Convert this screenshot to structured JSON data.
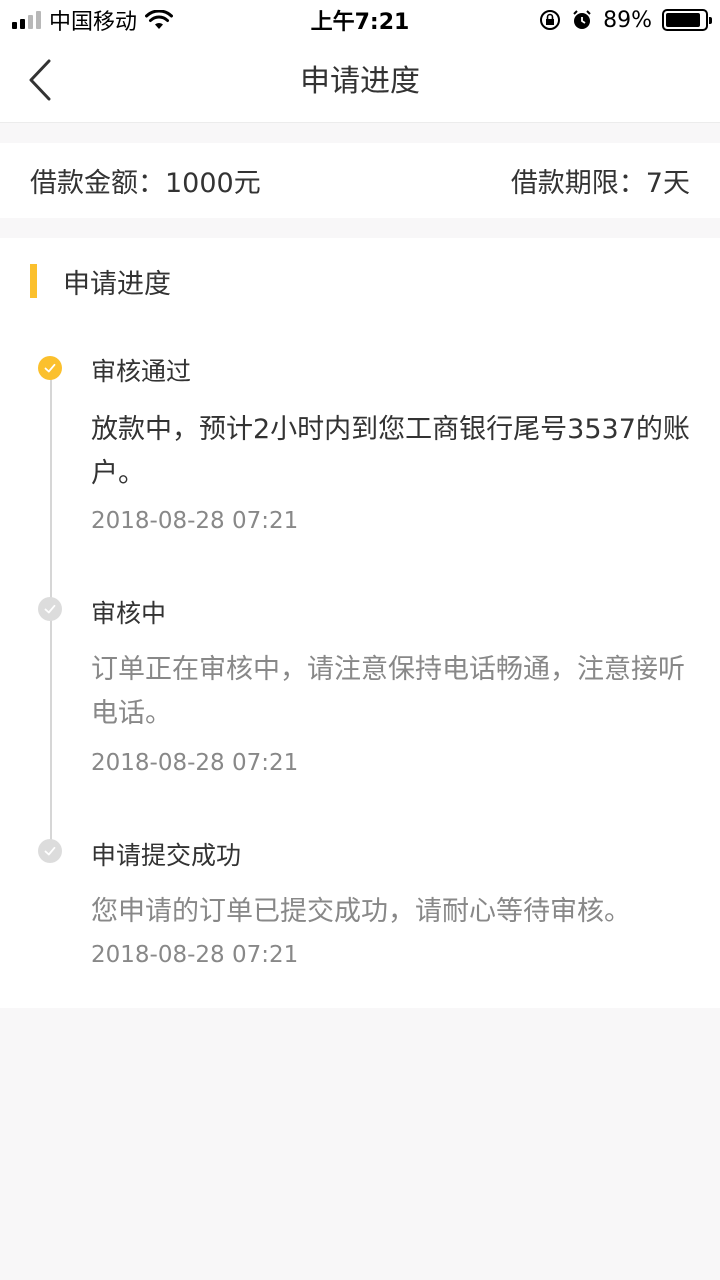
{
  "status_bar": {
    "carrier": "中国移动",
    "time": "上午7:21",
    "battery_percent": "89%",
    "battery_level": 0.89,
    "icons": [
      "signal-icon",
      "wifi-icon",
      "orientation-lock-icon",
      "alarm-icon",
      "battery-icon"
    ]
  },
  "nav": {
    "title": "申请进度",
    "back_icon": "chevron-left-icon"
  },
  "loan": {
    "amount_label": "借款金额：1000元",
    "term_label": "借款期限：7天"
  },
  "progress": {
    "section_title": "申请进度",
    "accent_color": "#fbc02d",
    "steps": [
      {
        "title": "审核通过",
        "desc": "放款中，预计2小时内到您工商银行尾号3537的账户。",
        "time": "2018-08-28 07:21",
        "state": "done"
      },
      {
        "title": "审核中",
        "desc": "订单正在审核中，请注意保持电话畅通，注意接听电话。",
        "time": "2018-08-28 07:21",
        "state": "pending"
      },
      {
        "title": "申请提交成功",
        "desc": "您申请的订单已提交成功，请耐心等待审核。",
        "time": "2018-08-28 07:21",
        "state": "pending"
      }
    ]
  }
}
